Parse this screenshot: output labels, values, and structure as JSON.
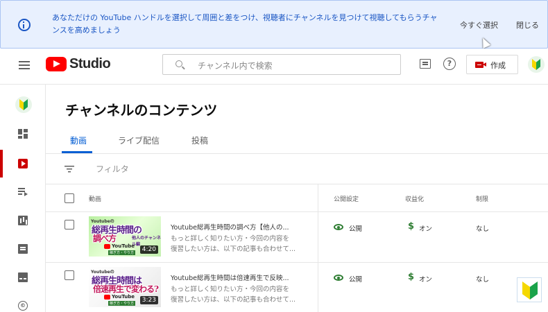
{
  "banner": {
    "message": "あなただけの YouTube ハンドルを選択して周囲と差をつけ、視聴者にチャンネルを見つけて視聴してもらうチャンスを高めましょう",
    "select_label": "今すぐ選択",
    "close_label": "閉じる",
    "accent": "#1a56c4"
  },
  "header": {
    "brand": "Studio",
    "search_placeholder": "チャンネル内で検索",
    "create_label": "作成"
  },
  "sidebar": {
    "items": [
      {
        "icon": "dashboard-icon"
      },
      {
        "icon": "content-icon",
        "active": true
      },
      {
        "icon": "playlist-icon"
      },
      {
        "icon": "analytics-icon"
      },
      {
        "icon": "comments-icon"
      },
      {
        "icon": "subtitles-icon"
      },
      {
        "icon": "copyright-icon",
        "glyph": "©"
      }
    ]
  },
  "main": {
    "title": "チャンネルのコンテンツ",
    "tabs": [
      {
        "label": "動画",
        "active": true
      },
      {
        "label": "ライブ配信"
      },
      {
        "label": "投稿"
      }
    ],
    "filter_label": "フィルタ",
    "columns": {
      "video": "動画",
      "visibility": "公開設定",
      "monetization": "収益化",
      "restrictions": "制限"
    },
    "rows": [
      {
        "thumb_small": "Youtubeの",
        "thumb_line1": "総再生時間の",
        "thumb_line2": "調べ方",
        "thumb_side": "他人のチャンネル編",
        "thumb_yt": "YouTube",
        "thumb_banner": "稼ぎ方・やり方",
        "duration": "4:20",
        "title": "Youtube総再生時間の調べ方【他人の...",
        "desc1": "もっと詳しく知りたい方・今回の内容を",
        "desc2": "復習したい方は、以下の記事も合わせて...",
        "visibility": "公開",
        "monetization": "オン",
        "restrictions": "なし"
      },
      {
        "thumb_small": "Youtubeの",
        "thumb_line1": "総再生時間は",
        "thumb_line2": "倍速再生で変わる?",
        "thumb_side": "",
        "thumb_yt": "YouTube",
        "thumb_banner": "稼ぎ方・やり方",
        "duration": "3:23",
        "title": "Youtube総再生時間は倍速再生で反映...",
        "desc1": "もっと詳しく知りたい方・今回の内容を",
        "desc2": "復習したい方は、以下の記事も合わせて...",
        "visibility": "公開",
        "monetization": "オン",
        "restrictions": "なし"
      }
    ],
    "monetization_glyph": "$"
  },
  "colors": {
    "brand_red": "#ff0000",
    "active_red": "#cc0000",
    "tab_blue": "#065fd4",
    "status_green": "#2e7d32",
    "beginner_yellow": "#f5d800",
    "beginner_green": "#1aa34a"
  }
}
